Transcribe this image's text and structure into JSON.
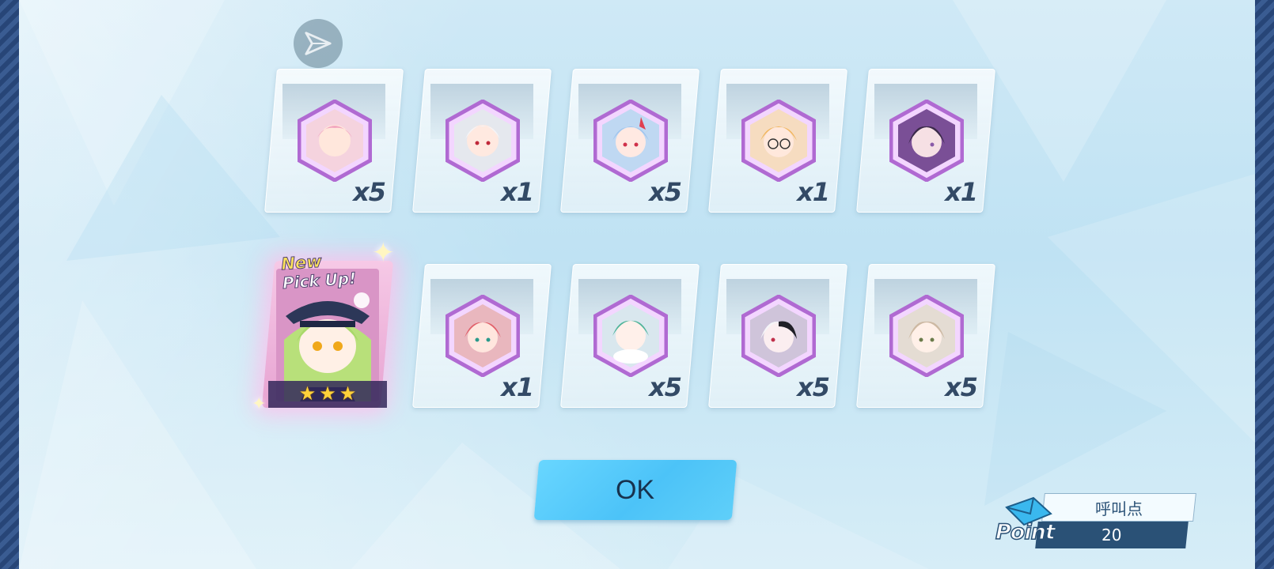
{
  "skip": {
    "icon": "send-arrow-icon"
  },
  "results": [
    {
      "character": "pink-haired-girl-portrait",
      "count": "x5"
    },
    {
      "character": "white-haired-girl-portrait",
      "count": "x1"
    },
    {
      "character": "blue-haired-horned-girl-portrait",
      "count": "x5"
    },
    {
      "character": "orange-haired-glasses-girl-portrait",
      "count": "x1"
    },
    {
      "character": "dark-haired-girl-portrait",
      "count": "x1"
    },
    {
      "character": "red-haired-girl-portrait",
      "count": "x1"
    },
    {
      "character": "green-haired-girl-portrait",
      "count": "x5"
    },
    {
      "character": "white-black-haired-girl-portrait",
      "count": "x5"
    },
    {
      "character": "beige-haired-girl-portrait",
      "count": "x5"
    }
  ],
  "pickup": {
    "tag_new": "New",
    "tag_pickup": "Pick Up!",
    "stars": 3,
    "character": "green-haired-captain-girl-portrait"
  },
  "ok_button": {
    "label": "OK"
  },
  "point": {
    "label": "呼叫点",
    "value": "20",
    "badge_text": "Point",
    "icon": "envelope-icon"
  },
  "colors": {
    "accent": "#4cc3f8",
    "star": "#ffd13a",
    "point_dark": "#2a5176",
    "frame_purple": "#b06ad2"
  }
}
